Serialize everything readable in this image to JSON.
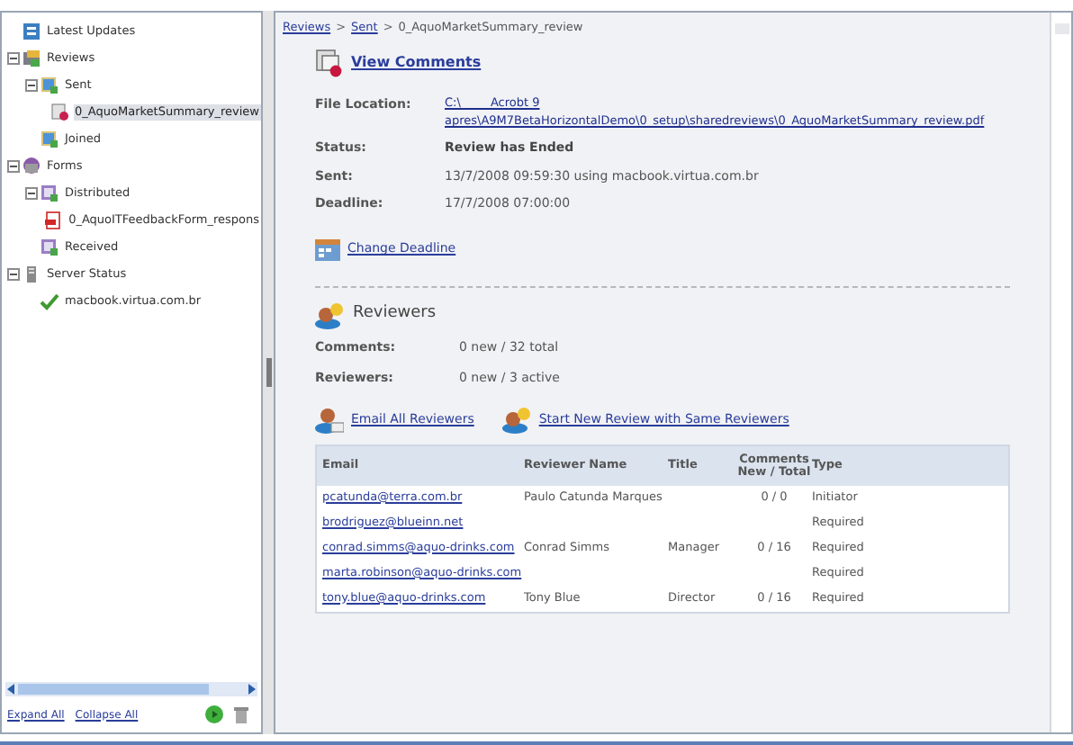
{
  "tree": [
    {
      "label": "Latest Updates",
      "kind": "updates",
      "selected": false
    },
    {
      "label": "Reviews",
      "kind": "reviews",
      "selected": false,
      "expanded": true,
      "children": [
        {
          "label": "Sent",
          "kind": "folder",
          "selected": false,
          "expanded": true,
          "children": [
            {
              "label": "0_AquoMarketSummary_review",
              "kind": "review-file",
              "selected": true
            }
          ]
        },
        {
          "label": "Joined",
          "kind": "folder",
          "selected": false
        }
      ]
    },
    {
      "label": "Forms",
      "kind": "forms",
      "selected": false,
      "expanded": true,
      "children": [
        {
          "label": "Distributed",
          "kind": "form-folder",
          "selected": false,
          "expanded": true,
          "children": [
            {
              "label": "0_AquoITFeedbackForm_respons",
              "kind": "pdf",
              "selected": false
            }
          ]
        },
        {
          "label": "Received",
          "kind": "form-folder",
          "selected": false
        }
      ]
    },
    {
      "label": "Server Status",
      "kind": "server",
      "selected": false,
      "expanded": true,
      "children": [
        {
          "label": "macbook.virtua.com.br",
          "kind": "check",
          "selected": false
        }
      ]
    }
  ],
  "tree_footer": {
    "expand_all": "Expand All",
    "collapse_all": "Collapse All"
  },
  "breadcrumb": [
    {
      "label": "Reviews",
      "link": true
    },
    {
      "label": "Sent",
      "link": true
    },
    {
      "label": "0_AquoMarketSummary_review",
      "link": false
    }
  ],
  "breadcrumb_separator": ">",
  "view_comments": "View Comments",
  "details": [
    {
      "label": "File Location:",
      "value_lines": [
        "C:\\        Acrobt 9",
        "apres\\A9M7BetaHorizontalDemo\\0_setup\\sharedreviews\\0_AquoMarketSummary_review.pdf"
      ],
      "kind": "link"
    },
    {
      "label": "Status:",
      "value": "Review has Ended",
      "kind": "bold"
    },
    {
      "label": "Sent:",
      "value": "13/7/2008 09:59:30 using macbook.virtua.com.br",
      "kind": "plain"
    },
    {
      "label": "Deadline:",
      "value": "17/7/2008 07:00:00",
      "kind": "plain"
    }
  ],
  "change_deadline": "Change Deadline",
  "reviewers_heading": "Reviewers",
  "reviewer_stats": [
    {
      "label": "Comments:",
      "value": "0 new / 32 total"
    },
    {
      "label": "Reviewers:",
      "value": "0 new / 3 active"
    }
  ],
  "actions": [
    "Email All Reviewers",
    "Start New Review with Same Reviewers"
  ],
  "table": {
    "columns": [
      "Email",
      "Reviewer Name",
      "Title",
      "Comments\nNew / Total",
      "Type"
    ],
    "rows": [
      {
        "email": "pcatunda@terra.com.br",
        "name": "Paulo Catunda Marques",
        "comments": "0 / 0",
        "type": "Initiator"
      },
      {
        "email": "brodriguez@blueinn.net",
        "type": "Required"
      },
      {
        "email": "conrad.simms@aquo-drinks.com",
        "name": "Conrad Simms",
        "title": "Manager",
        "comments": "0 / 16",
        "type": "Required"
      },
      {
        "email": "marta.robinson@aquo-drinks.com",
        "type": "Required"
      },
      {
        "email": "tony.blue@aquo-drinks.com",
        "name": "Tony Blue",
        "title": "Director",
        "comments": "0 / 16",
        "type": "Required"
      }
    ]
  }
}
